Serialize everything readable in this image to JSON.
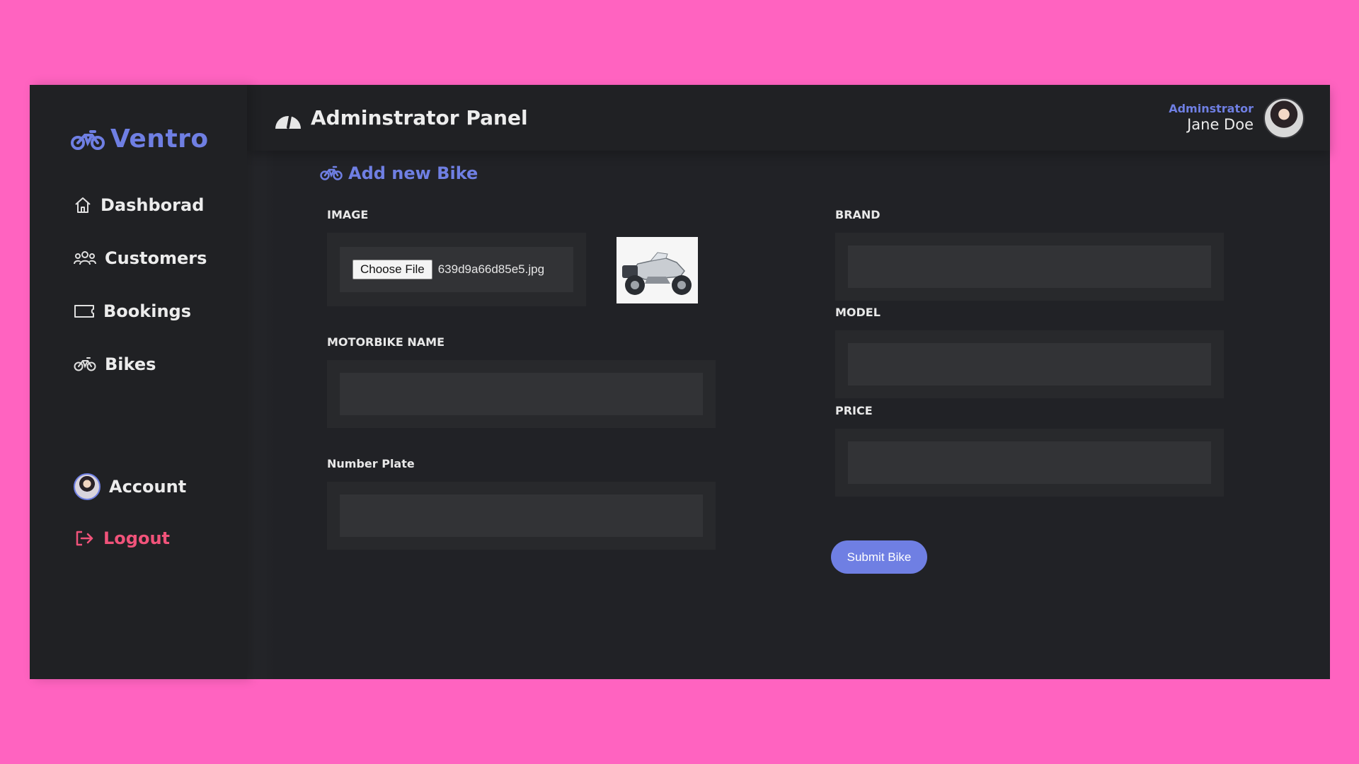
{
  "brand": {
    "name": "Ventro",
    "icon": "motorbike-icon"
  },
  "sidebar": {
    "items": [
      {
        "label": "Dashborad",
        "icon": "home-icon"
      },
      {
        "label": "Customers",
        "icon": "users-icon"
      },
      {
        "label": "Bookings",
        "icon": "ticket-icon"
      },
      {
        "label": "Bikes",
        "icon": "motorbike-icon"
      }
    ],
    "account": {
      "label": "Account",
      "icon": "avatar"
    },
    "logout": {
      "label": "Logout",
      "icon": "logout-icon"
    }
  },
  "header": {
    "title": "Adminstrator Panel",
    "icon": "speedometer-icon",
    "user_role": "Adminstrator",
    "user_name": "Jane Doe"
  },
  "form": {
    "title": "Add new Bike",
    "image_label": "IMAGE",
    "choose_file_label": "Choose File",
    "file_name": "639d9a66d85e5.jpg",
    "motorbike_name_label": "MOTORBIKE NAME",
    "motorbike_name_value": "",
    "number_plate_label": "Number Plate",
    "number_plate_value": "",
    "brand_label": "BRAND",
    "brand_value": "",
    "model_label": "MODEL",
    "model_value": "",
    "price_label": "PRICE",
    "price_value": "",
    "submit_label": "Submit Bike"
  },
  "colors": {
    "accent": "#6f7fe3",
    "background": "#ff63c0",
    "panel": "#202124",
    "logout": "#f0537a"
  }
}
